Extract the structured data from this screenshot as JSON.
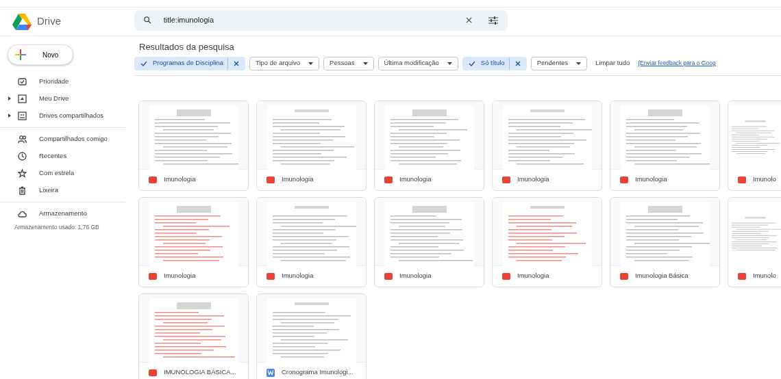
{
  "app": {
    "title": "Drive"
  },
  "search": {
    "value": "title:imunologia"
  },
  "sidebar": {
    "new_button": "Novo",
    "groups": [
      [
        {
          "label": "Prioridade",
          "kind": "plain"
        },
        {
          "label": "Meu Drive",
          "kind": "tree"
        },
        {
          "label": "Drives compartilhados",
          "kind": "tree"
        }
      ],
      [
        {
          "label": "Compartilhados comigo",
          "kind": "plain"
        },
        {
          "label": "Recentes",
          "kind": "plain"
        },
        {
          "label": "Com estrela",
          "kind": "plain"
        },
        {
          "label": "Lixeira",
          "kind": "plain"
        }
      ],
      [
        {
          "label": "Armazenamento",
          "kind": "plain"
        }
      ]
    ],
    "storage_usage": "Armazenamento usado: 1,76 GB"
  },
  "results": {
    "title": "Resultados da pesquisa",
    "filters": [
      {
        "label": "Programas de Disciplina",
        "selected": true
      },
      {
        "label": "Tipo de arquivo",
        "selected": false
      },
      {
        "label": "Pessoas",
        "selected": false
      },
      {
        "label": "Última modificação",
        "selected": false
      },
      {
        "label": "Só título",
        "selected": true
      },
      {
        "label": "Pendentes",
        "selected": false
      }
    ],
    "clear_all": "Limpar tudo",
    "feedback_link": "(Enviar feedback para o Goog",
    "files": [
      [
        {
          "name": "Imunologia",
          "kind": "pdf"
        },
        {
          "name": "Imunologia",
          "kind": "pdf"
        },
        {
          "name": "Imunologia",
          "kind": "pdf"
        },
        {
          "name": "Imunologia",
          "kind": "pdf"
        },
        {
          "name": "Imunologia",
          "kind": "pdf"
        },
        {
          "name": "Imunolo",
          "kind": "pdf"
        }
      ],
      [
        {
          "name": "Imunologia",
          "kind": "pdf"
        },
        {
          "name": "Imunologia",
          "kind": "pdf"
        },
        {
          "name": "Imunologia",
          "kind": "pdf"
        },
        {
          "name": "Imunologia",
          "kind": "pdf"
        },
        {
          "name": "Imunologia Básica",
          "kind": "pdf"
        },
        {
          "name": "Imunolo",
          "kind": "pdf"
        }
      ],
      [
        {
          "name": "IMUNOLOGIA BÁSICA...",
          "kind": "pdf"
        },
        {
          "name": "Cronograma Imunologi...",
          "kind": "word"
        }
      ]
    ]
  }
}
